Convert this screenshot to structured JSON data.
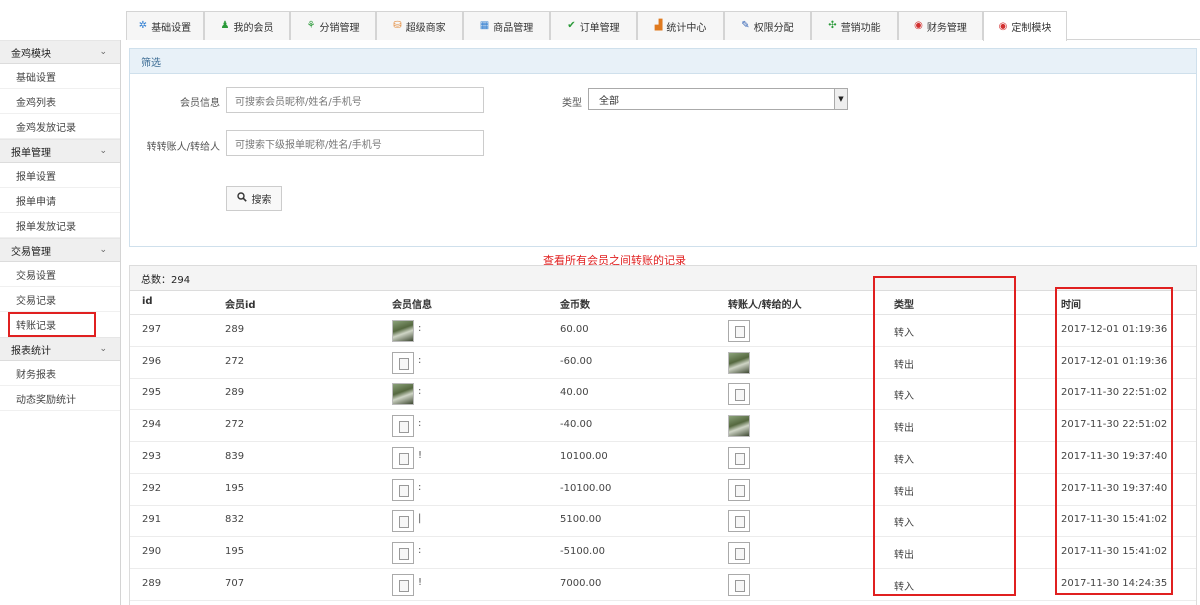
{
  "tabs": [
    {
      "label": "基础设置",
      "icon": "gear-icon",
      "glyph": "✲",
      "color": "#2e7dd1"
    },
    {
      "label": "我的会员",
      "icon": "user-icon",
      "glyph": "♟",
      "color": "#2b9a3a"
    },
    {
      "label": "分销管理",
      "icon": "tree-icon",
      "glyph": "⚘",
      "color": "#2b9a3a"
    },
    {
      "label": "超级商家",
      "icon": "store-icon",
      "glyph": "⛁",
      "color": "#e07a1f"
    },
    {
      "label": "商品管理",
      "icon": "grid-icon",
      "glyph": "▦",
      "color": "#2e7dd1"
    },
    {
      "label": "订单管理",
      "icon": "order-icon",
      "glyph": "✔",
      "color": "#2b9a3a"
    },
    {
      "label": "统计中心",
      "icon": "stats-icon",
      "glyph": "▟",
      "color": "#e07a1f"
    },
    {
      "label": "权限分配",
      "icon": "wrench-icon",
      "glyph": "✎",
      "color": "#2e5fb3"
    },
    {
      "label": "营销功能",
      "icon": "network-icon",
      "glyph": "✣",
      "color": "#2b9a3a"
    },
    {
      "label": "财务管理",
      "icon": "finance-icon",
      "glyph": "◉",
      "color": "#d23030"
    },
    {
      "label": "定制模块",
      "icon": "custom-icon",
      "glyph": "◉",
      "color": "#d23030"
    }
  ],
  "sidebar": {
    "groups": [
      {
        "title": "金鸡模块",
        "items": [
          "基础设置",
          "金鸡列表",
          "金鸡发放记录"
        ]
      },
      {
        "title": "报单管理",
        "items": [
          "报单设置",
          "报单申请",
          "报单发放记录"
        ]
      },
      {
        "title": "交易管理",
        "items": [
          "交易设置",
          "交易记录",
          "转账记录"
        ]
      },
      {
        "title": "报表统计",
        "items": [
          "财务报表",
          "动态奖励统计"
        ]
      }
    ]
  },
  "filter": {
    "title": "筛选",
    "member_label": "会员信息",
    "member_placeholder": "可搜索会员昵称/姓名/手机号",
    "type_label": "类型",
    "type_value": "全部",
    "transfer_label": "转转账人/转给人",
    "transfer_placeholder": "可搜索下级报单昵称/姓名/手机号",
    "search_label": "搜索"
  },
  "annotation": "查看所有会员之间转账的记录",
  "list": {
    "total_label": "总数：294",
    "columns": [
      "id",
      "会员id",
      "会员信息",
      "金币数",
      "转账人/转给的人",
      "类型",
      "时间"
    ],
    "rows": [
      {
        "id": "297",
        "member_id": "289",
        "member_img": "photo",
        "member_mark": ":",
        "amount": "60.00",
        "other_img": "blank",
        "type": "转入",
        "time": "2017-12-01 01:19:36"
      },
      {
        "id": "296",
        "member_id": "272",
        "member_img": "blank",
        "member_mark": ":",
        "amount": "-60.00",
        "other_img": "photo",
        "type": "转出",
        "time": "2017-12-01 01:19:36"
      },
      {
        "id": "295",
        "member_id": "289",
        "member_img": "photo",
        "member_mark": ":",
        "amount": "40.00",
        "other_img": "blank",
        "type": "转入",
        "time": "2017-11-30 22:51:02"
      },
      {
        "id": "294",
        "member_id": "272",
        "member_img": "blank",
        "member_mark": ":",
        "amount": "-40.00",
        "other_img": "photo",
        "type": "转出",
        "time": "2017-11-30 22:51:02"
      },
      {
        "id": "293",
        "member_id": "839",
        "member_img": "blank",
        "member_mark": "!",
        "amount": "10100.00",
        "other_img": "blank",
        "type": "转入",
        "time": "2017-11-30 19:37:40"
      },
      {
        "id": "292",
        "member_id": "195",
        "member_img": "blank",
        "member_mark": ":",
        "amount": "-10100.00",
        "other_img": "blank",
        "type": "转出",
        "time": "2017-11-30 19:37:40"
      },
      {
        "id": "291",
        "member_id": "832",
        "member_img": "blank",
        "member_mark": "|",
        "amount": "5100.00",
        "other_img": "blank",
        "type": "转入",
        "time": "2017-11-30 15:41:02"
      },
      {
        "id": "290",
        "member_id": "195",
        "member_img": "blank",
        "member_mark": ":",
        "amount": "-5100.00",
        "other_img": "blank",
        "type": "转出",
        "time": "2017-11-30 15:41:02"
      },
      {
        "id": "289",
        "member_id": "707",
        "member_img": "blank",
        "member_mark": "!",
        "amount": "7000.00",
        "other_img": "blank",
        "type": "转入",
        "time": "2017-11-30 14:24:35"
      }
    ]
  }
}
